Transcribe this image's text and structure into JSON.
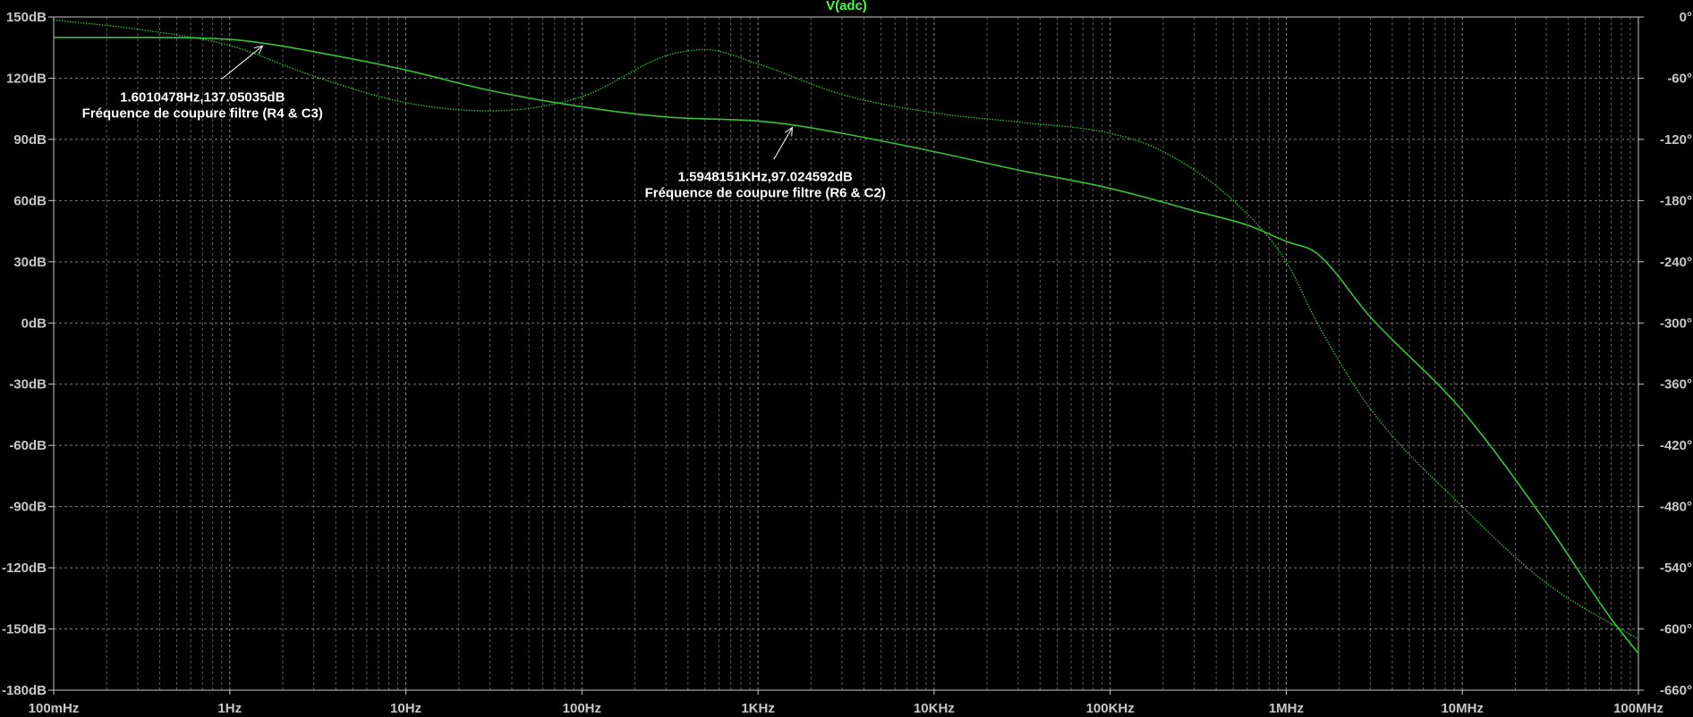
{
  "chart_data": {
    "type": "line",
    "title": "V(adc)",
    "x_scale": "log",
    "xlim_hz": [
      0.1,
      100000000
    ],
    "x_ticks": [
      {
        "hz": 0.1,
        "label": "100mHz"
      },
      {
        "hz": 1,
        "label": "1Hz"
      },
      {
        "hz": 10,
        "label": "10Hz"
      },
      {
        "hz": 100,
        "label": "100Hz"
      },
      {
        "hz": 1000,
        "label": "1KHz"
      },
      {
        "hz": 10000,
        "label": "10KHz"
      },
      {
        "hz": 100000,
        "label": "100KHz"
      },
      {
        "hz": 1000000,
        "label": "1MHz"
      },
      {
        "hz": 10000000,
        "label": "10MHz"
      },
      {
        "hz": 100000000,
        "label": "100MHz"
      }
    ],
    "ylim_left_db": [
      -180,
      150
    ],
    "left_ticks": [
      {
        "v": 150,
        "label": "150dB"
      },
      {
        "v": 120,
        "label": "120dB"
      },
      {
        "v": 90,
        "label": "90dB"
      },
      {
        "v": 60,
        "label": "60dB"
      },
      {
        "v": 30,
        "label": "30dB"
      },
      {
        "v": 0,
        "label": "0dB"
      },
      {
        "v": -30,
        "label": "-30dB"
      },
      {
        "v": -60,
        "label": "-60dB"
      },
      {
        "v": -90,
        "label": "-90dB"
      },
      {
        "v": -120,
        "label": "-120dB"
      },
      {
        "v": -150,
        "label": "-150dB"
      },
      {
        "v": -180,
        "label": "-180dB"
      }
    ],
    "ylim_right_deg": [
      -660,
      0
    ],
    "right_ticks": [
      {
        "v": 0,
        "label": "0°"
      },
      {
        "v": -60,
        "label": "-60°"
      },
      {
        "v": -120,
        "label": "-120°"
      },
      {
        "v": -180,
        "label": "-180°"
      },
      {
        "v": -240,
        "label": "-240°"
      },
      {
        "v": -300,
        "label": "-300°"
      },
      {
        "v": -360,
        "label": "-360°"
      },
      {
        "v": -420,
        "label": "-420°"
      },
      {
        "v": -480,
        "label": "-480°"
      },
      {
        "v": -540,
        "label": "-540°"
      },
      {
        "v": -600,
        "label": "-600°"
      },
      {
        "v": -660,
        "label": "-660°"
      }
    ],
    "grid": true,
    "colors": {
      "background": "#000000",
      "grid": "#9a9a9a",
      "axis": "#c8c8c8",
      "trace": "#36c236",
      "title": "#44ff44",
      "annotation": "#ffffff"
    },
    "series": [
      {
        "axis": "left",
        "style": "solid",
        "points": [
          [
            0.1,
            140
          ],
          [
            0.3,
            140
          ],
          [
            1,
            139
          ],
          [
            1.6,
            137
          ],
          [
            3,
            133
          ],
          [
            10,
            124
          ],
          [
            30,
            114
          ],
          [
            100,
            106
          ],
          [
            300,
            101
          ],
          [
            1000,
            99
          ],
          [
            1600,
            97
          ],
          [
            3000,
            93
          ],
          [
            10000,
            84
          ],
          [
            30000,
            75
          ],
          [
            100000,
            66
          ],
          [
            300000,
            55
          ],
          [
            600000,
            48
          ],
          [
            1000000,
            40
          ],
          [
            1500000,
            34
          ],
          [
            3000000,
            3
          ],
          [
            10000000,
            -43
          ],
          [
            30000000,
            -98
          ],
          [
            70000000,
            -145
          ],
          [
            100000000,
            -162
          ]
        ]
      },
      {
        "axis": "right",
        "style": "dotted",
        "points": [
          [
            0.1,
            -3
          ],
          [
            0.3,
            -12
          ],
          [
            1,
            -28
          ],
          [
            3,
            -58
          ],
          [
            10,
            -84
          ],
          [
            30,
            -92
          ],
          [
            100,
            -78
          ],
          [
            300,
            -38
          ],
          [
            500,
            -32
          ],
          [
            1000,
            -46
          ],
          [
            3000,
            -76
          ],
          [
            10000,
            -94
          ],
          [
            30000,
            -103
          ],
          [
            100000,
            -114
          ],
          [
            200000,
            -132
          ],
          [
            500000,
            -180
          ],
          [
            1000000,
            -240
          ],
          [
            1500000,
            -300
          ],
          [
            3000000,
            -384
          ],
          [
            10000000,
            -480
          ],
          [
            30000000,
            -555
          ],
          [
            100000000,
            -610
          ]
        ]
      }
    ],
    "annotations": [
      {
        "id": "cut1",
        "hz": 1.6010478,
        "db": 137.05035,
        "text_hz": 0.7,
        "text_db": 112,
        "line1": "1.6010478Hz,137.05035dB",
        "line2": "Fréquence de coupure filtre (R4 & C3)"
      },
      {
        "id": "cut2",
        "hz": 1594.8151,
        "db": 97.024592,
        "text_hz": 1100,
        "text_db": 73,
        "line1": "1.5948151KHz,97.024592dB",
        "line2": "Fréquence de coupure filtre (R6 & C2)"
      }
    ]
  }
}
